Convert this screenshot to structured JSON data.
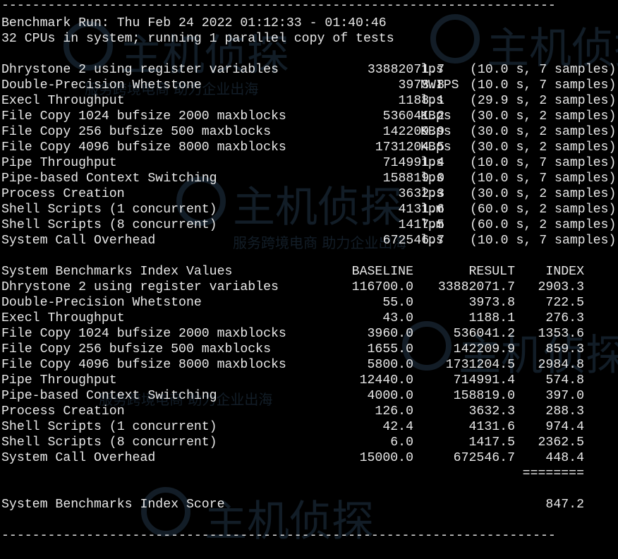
{
  "separator": "------------------------------------------------------------------------",
  "header": {
    "run_line": "Benchmark Run: Thu Feb 24 2022 01:12:33 - 01:40:46",
    "cpu_line": "32 CPUs in system; running 1 parallel copy of tests"
  },
  "results": [
    {
      "name": "Dhrystone 2 using register variables",
      "score": "33882071.7",
      "unit": "lps",
      "samples": "(10.0 s, 7 samples)"
    },
    {
      "name": "Double-Precision Whetstone",
      "score": "3973.8",
      "unit": "MWIPS",
      "samples": "(10.0 s, 7 samples)"
    },
    {
      "name": "Execl Throughput",
      "score": "1188.1",
      "unit": "lps",
      "samples": "(29.9 s, 2 samples)"
    },
    {
      "name": "File Copy 1024 bufsize 2000 maxblocks",
      "score": "536041.2",
      "unit": "KBps",
      "samples": "(30.0 s, 2 samples)"
    },
    {
      "name": "File Copy 256 bufsize 500 maxblocks",
      "score": "142209.9",
      "unit": "KBps",
      "samples": "(30.0 s, 2 samples)"
    },
    {
      "name": "File Copy 4096 bufsize 8000 maxblocks",
      "score": "1731204.5",
      "unit": "KBps",
      "samples": "(30.0 s, 2 samples)"
    },
    {
      "name": "Pipe Throughput",
      "score": "714991.4",
      "unit": "lps",
      "samples": "(10.0 s, 7 samples)"
    },
    {
      "name": "Pipe-based Context Switching",
      "score": "158819.0",
      "unit": "lps",
      "samples": "(10.0 s, 7 samples)"
    },
    {
      "name": "Process Creation",
      "score": "3632.3",
      "unit": "lps",
      "samples": "(30.0 s, 2 samples)"
    },
    {
      "name": "Shell Scripts (1 concurrent)",
      "score": "4131.6",
      "unit": "lpm",
      "samples": "(60.0 s, 2 samples)"
    },
    {
      "name": "Shell Scripts (8 concurrent)",
      "score": "1417.5",
      "unit": "lpm",
      "samples": "(60.0 s, 2 samples)"
    },
    {
      "name": "System Call Overhead",
      "score": "672546.7",
      "unit": "lps",
      "samples": "(10.0 s, 7 samples)"
    }
  ],
  "index": {
    "title": "System Benchmarks Index Values",
    "col_baseline": "BASELINE",
    "col_result": "RESULT",
    "col_index": "INDEX",
    "rows": [
      {
        "name": "Dhrystone 2 using register variables",
        "baseline": "116700.0",
        "result": "33882071.7",
        "index": "2903.3"
      },
      {
        "name": "Double-Precision Whetstone",
        "baseline": "55.0",
        "result": "3973.8",
        "index": "722.5"
      },
      {
        "name": "Execl Throughput",
        "baseline": "43.0",
        "result": "1188.1",
        "index": "276.3"
      },
      {
        "name": "File Copy 1024 bufsize 2000 maxblocks",
        "baseline": "3960.0",
        "result": "536041.2",
        "index": "1353.6"
      },
      {
        "name": "File Copy 256 bufsize 500 maxblocks",
        "baseline": "1655.0",
        "result": "142209.9",
        "index": "859.3"
      },
      {
        "name": "File Copy 4096 bufsize 8000 maxblocks",
        "baseline": "5800.0",
        "result": "1731204.5",
        "index": "2984.8"
      },
      {
        "name": "Pipe Throughput",
        "baseline": "12440.0",
        "result": "714991.4",
        "index": "574.8"
      },
      {
        "name": "Pipe-based Context Switching",
        "baseline": "4000.0",
        "result": "158819.0",
        "index": "397.0"
      },
      {
        "name": "Process Creation",
        "baseline": "126.0",
        "result": "3632.3",
        "index": "288.3"
      },
      {
        "name": "Shell Scripts (1 concurrent)",
        "baseline": "42.4",
        "result": "4131.6",
        "index": "974.4"
      },
      {
        "name": "Shell Scripts (8 concurrent)",
        "baseline": "6.0",
        "result": "1417.5",
        "index": "2362.5"
      },
      {
        "name": "System Call Overhead",
        "baseline": "15000.0",
        "result": "672546.7",
        "index": "448.4"
      }
    ],
    "total_rule": "========",
    "score_label": "System Benchmarks Index Score",
    "score_value": "847.2"
  },
  "watermark": {
    "brand": "主机侦探",
    "slogan": "服务跨境电商 助力企业出海"
  },
  "colors": {
    "background": "#000000",
    "text": "#e8e8e8",
    "watermark": "#3a5a7a"
  }
}
